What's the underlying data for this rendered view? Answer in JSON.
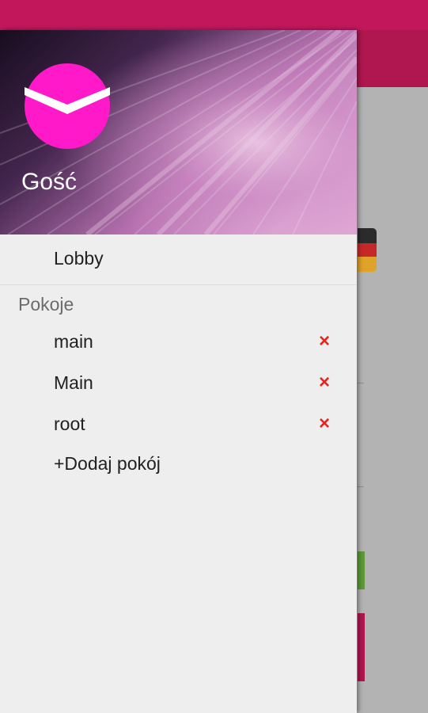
{
  "colors": {
    "status_bar": "#c2185b",
    "toolbar": "#b0164f",
    "avatar": "#ff19c8",
    "remove_icon": "#e8231f",
    "drawer_background": "#eeeeee"
  },
  "drawer": {
    "header": {
      "avatar_icon": "envelope-icon",
      "user_name": "Gość"
    },
    "lobby_label": "Lobby",
    "rooms_section_title": "Pokoje",
    "rooms": [
      {
        "label": "main",
        "remove_icon": "×"
      },
      {
        "label": "Main",
        "remove_icon": "×"
      },
      {
        "label": "root",
        "remove_icon": "×"
      }
    ],
    "add_room_label": "+Dodaj pokój"
  }
}
